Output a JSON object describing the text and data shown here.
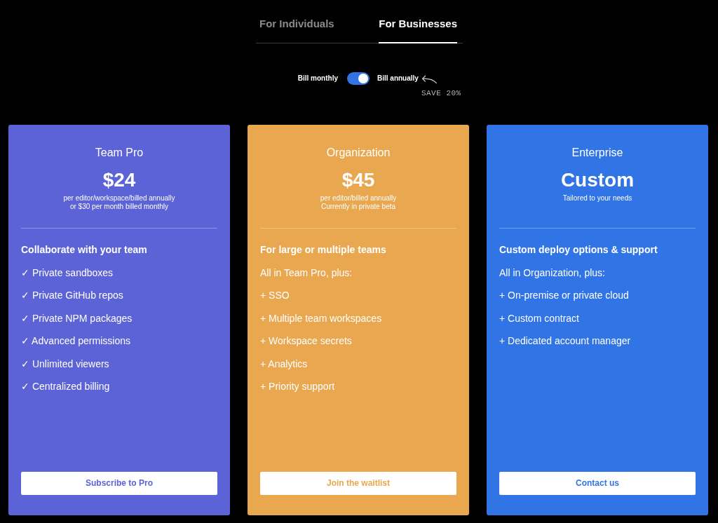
{
  "tabs": [
    {
      "label": "For Individuals",
      "selected": false
    },
    {
      "label": "For Businesses",
      "selected": true
    }
  ],
  "billing": {
    "monthly_label": "Bill monthly",
    "annual_label": "Bill annually",
    "annual": true,
    "note": "SAVE 20%"
  },
  "plans": [
    {
      "name": "Team Pro",
      "color": "#5b63d6",
      "price": "$24",
      "details": [
        "per editor/workspace/billed annually",
        "or $30 per month billed monthly"
      ],
      "heading": "Collaborate with your team",
      "features": [
        "✓ Private sandboxes",
        "✓ Private GitHub repos",
        "✓ Private NPM packages",
        "✓ Advanced permissions",
        "✓ Unlimited viewers",
        "✓ Centralized billing"
      ],
      "button": "Subscribe to Pro"
    },
    {
      "name": "Organization",
      "color": "#e9a74f",
      "price": "$45",
      "details": [
        "per editor/billed annually",
        "Currently in private beta"
      ],
      "heading": "For large or multiple teams",
      "features": [
        "All in Team Pro, plus:",
        "+ SSO",
        "+ Multiple team workspaces",
        "+ Workspace secrets",
        "+ Analytics",
        "+ Priority support"
      ],
      "button": "Join the waitlist"
    },
    {
      "name": "Enterprise",
      "color": "#3174e5",
      "price": "Custom",
      "details": [
        "Tailored to your needs"
      ],
      "heading": "Custom deploy options & support",
      "features": [
        "All in Organization, plus:",
        "+ On-premise or private cloud",
        "+ Custom contract",
        "+ Dedicated account manager"
      ],
      "button": "Contact us"
    }
  ]
}
